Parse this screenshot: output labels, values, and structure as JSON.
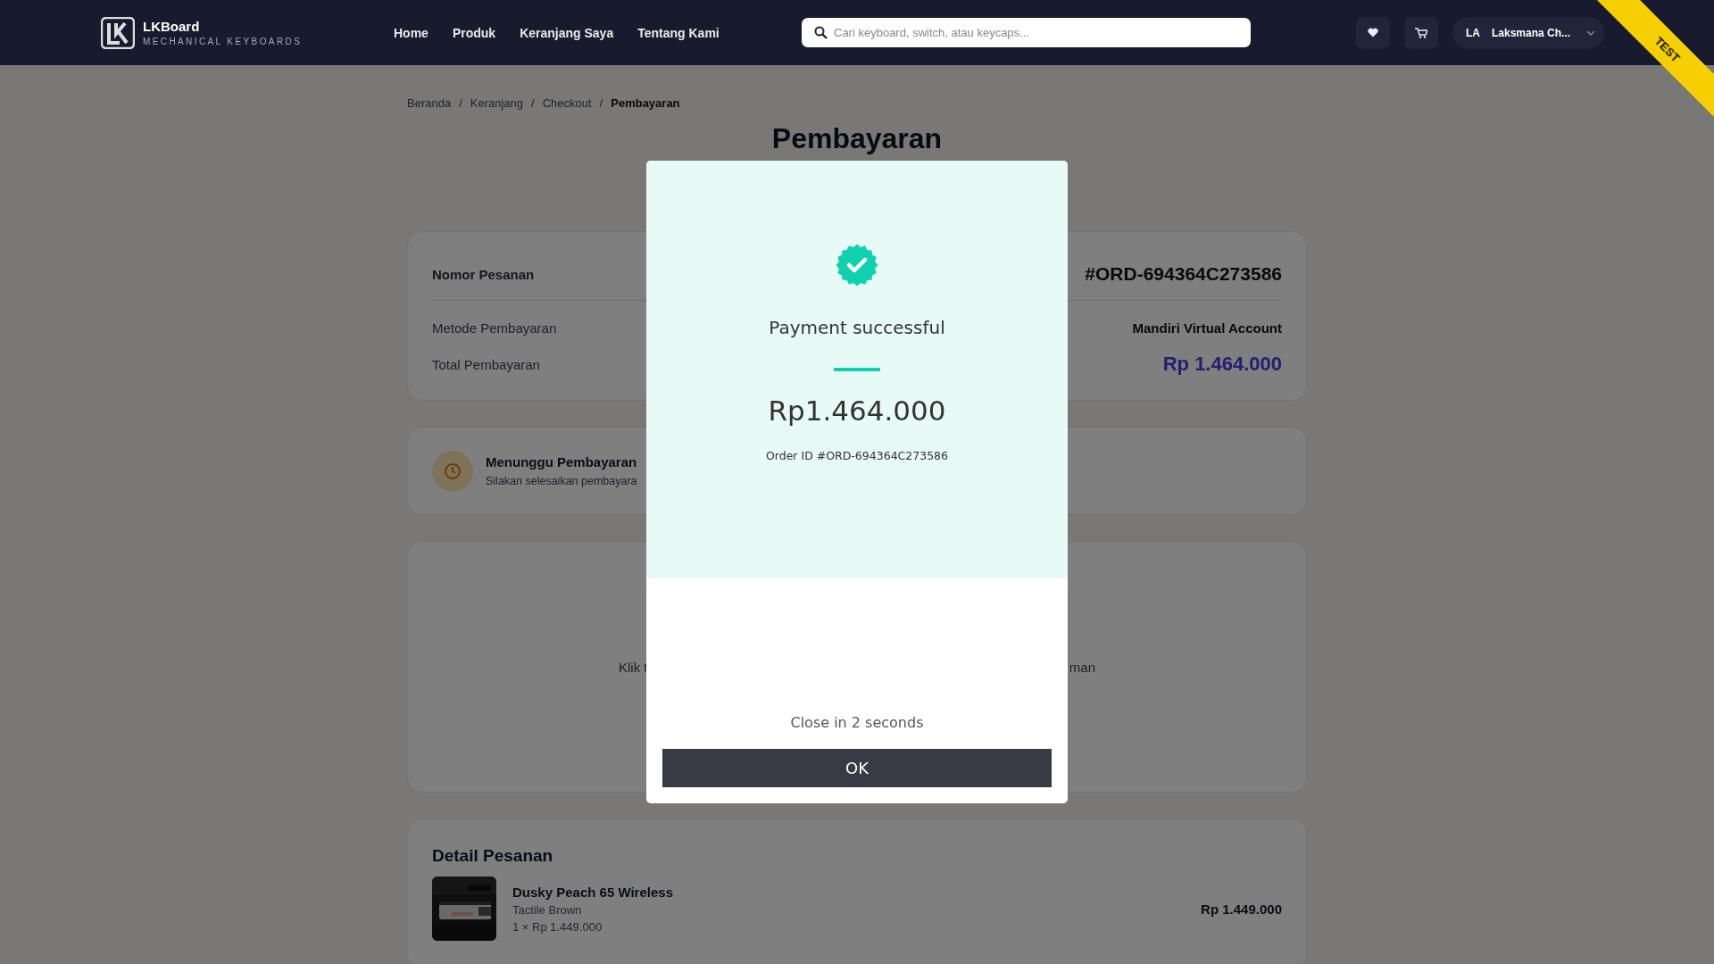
{
  "header": {
    "brand": "LKBoard",
    "tagline": "MECHANICAL KEYBOARDS",
    "nav": [
      {
        "label": "Home"
      },
      {
        "label": "Produk"
      },
      {
        "label": "Keranjang Saya"
      },
      {
        "label": "Tentang Kami"
      }
    ],
    "search": {
      "placeholder": "Cari keyboard, switch, atau keycaps..."
    },
    "user": {
      "initials": "LA",
      "name": "Laksmana Ch..."
    },
    "ribbon": "TEST"
  },
  "breadcrumb": [
    {
      "kind": "link",
      "label": "Beranda"
    },
    {
      "kind": "separator",
      "label": "/"
    },
    {
      "kind": "link",
      "label": "Keranjang"
    },
    {
      "kind": "separator",
      "label": "/"
    },
    {
      "kind": "link",
      "label": "Checkout"
    },
    {
      "kind": "separator",
      "label": "/"
    },
    {
      "kind": "current",
      "label": "Pembayaran"
    }
  ],
  "page_title": "Pembayaran",
  "order_summary": [
    {
      "kind": "order_number",
      "label": "Nomor Pesanan",
      "value": "#ORD-694364C273586"
    },
    {
      "kind": "method",
      "label": "Metode Pembayaran",
      "value": "Mandiri Virtual Account"
    },
    {
      "kind": "total",
      "label": "Total Pembayaran",
      "value": "Rp 1.464.000"
    }
  ],
  "status": {
    "title": "Menunggu Pembayaran",
    "text": "Silakan selesaikan pembayara"
  },
  "instruction": {
    "left": "Klik t",
    "right": "man"
  },
  "order_detail": {
    "title": "Detail Pesanan",
    "items": [
      {
        "kind": "picture",
        "name": "Dusky Peach 65 Wireless",
        "variant": "Tactile Brown",
        "quantity_price": "1 × Rp 1.449.000",
        "price": "Rp 1.449.000"
      }
    ]
  },
  "modal": {
    "title": "Payment successful",
    "amount": "Rp1.464.000",
    "order_id": "Order ID #ORD-694364C273586",
    "countdown": "Close in 2 seconds",
    "button": "OK"
  }
}
